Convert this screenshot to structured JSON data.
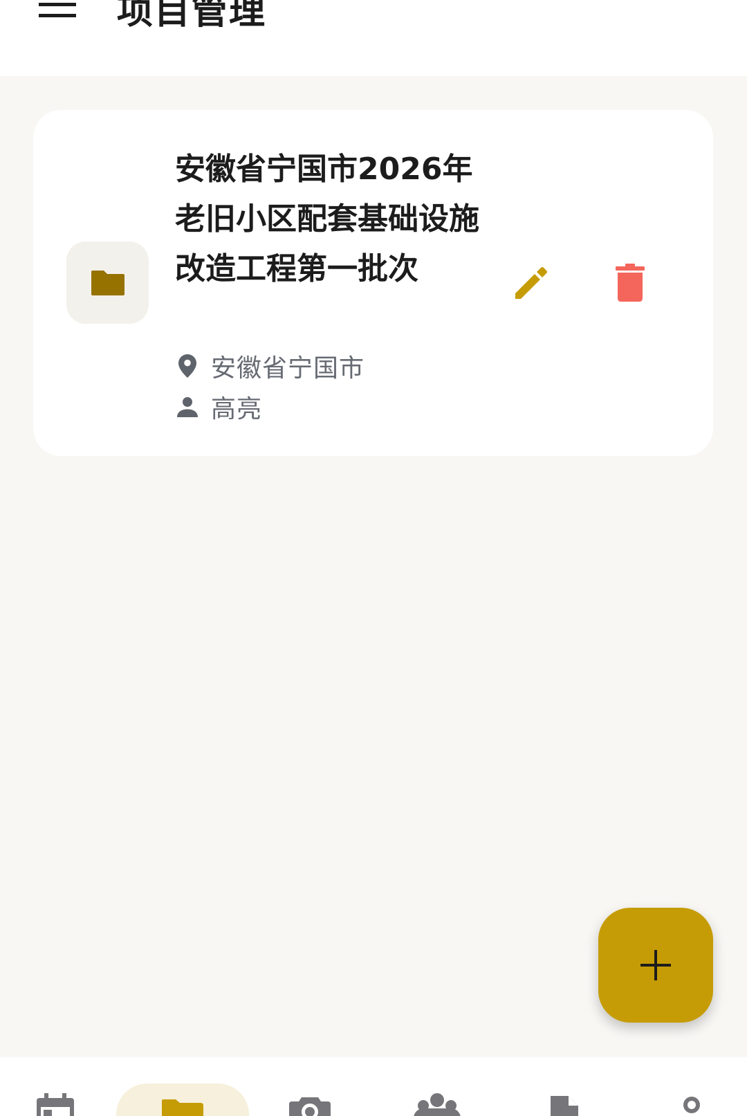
{
  "app_bar": {
    "title": "项目管理",
    "menu_icon": "menu-icon"
  },
  "project_card": {
    "title": "安徽省宁国市2026年老旧小区配套基础设施改造工程第一批次",
    "location": "安徽省宁国市",
    "manager": "高亮",
    "icons": {
      "folder": "folder-icon",
      "location": "location-pin-icon",
      "person": "person-icon",
      "edit": "pencil-icon",
      "delete": "trash-icon"
    }
  },
  "fab": {
    "icon": "plus-icon"
  },
  "bottom_nav": {
    "items": [
      {
        "icon": "calendar-icon",
        "selected": false
      },
      {
        "icon": "folder-icon",
        "selected": true
      },
      {
        "icon": "camera-icon",
        "selected": false
      },
      {
        "icon": "group-icon",
        "selected": false
      },
      {
        "icon": "document-icon",
        "selected": false
      },
      {
        "icon": "person-icon",
        "selected": false
      }
    ]
  },
  "colors": {
    "accent": "#C69C06",
    "folder_dark": "#967200",
    "delete_red": "#F4665B",
    "background": "#F8F7F4",
    "card": "#FFFFFF",
    "meta_text": "#666A72",
    "nav_icon": "#76767A",
    "nav_selected_bg": "#F6F0DC"
  }
}
